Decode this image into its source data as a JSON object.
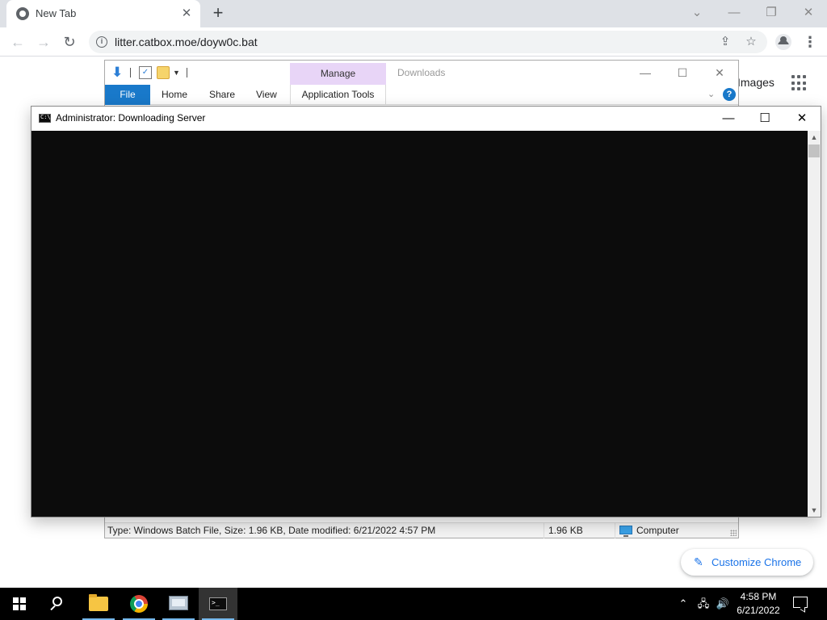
{
  "browser": {
    "tab_title": "New Tab",
    "tab_close_glyph": "✕",
    "new_tab_glyph": "+",
    "url": "litter.catbox.moe/doyw0c.bat",
    "ntp_images_link": "Images",
    "customize_chrome_label": "Customize Chrome",
    "accent_color": "#1a73e8",
    "icons": {
      "back": "back-arrow-icon",
      "forward": "forward-arrow-icon",
      "reload": "reload-icon",
      "site_info": "info-icon",
      "share": "share-icon",
      "bookmark": "star-icon",
      "profile": "profile-icon",
      "menu": "kebab-menu-icon",
      "apps": "apps-grid-icon"
    }
  },
  "explorer": {
    "title": "Downloads",
    "manage_tab": "Manage",
    "ribbon_tabs": [
      "File",
      "Home",
      "Share",
      "View"
    ],
    "contextual_tab": "Application Tools",
    "help_glyph": "?",
    "status": {
      "details": "Type: Windows Batch File, Size: 1.96 KB, Date modified: 6/21/2022 4:57 PM",
      "size": "1.96 KB",
      "location": "Computer"
    },
    "ribbon_file_color": "#1979ca",
    "manage_color": "#e8d5f7"
  },
  "console": {
    "title": "Administrator:  Downloading Server",
    "background_color": "#0c0c0c"
  },
  "taskbar": {
    "time": "4:58 PM",
    "date": "6/21/2022",
    "apps": [
      "file-explorer",
      "chrome",
      "network-app",
      "command-prompt"
    ],
    "active_app": "command-prompt"
  }
}
